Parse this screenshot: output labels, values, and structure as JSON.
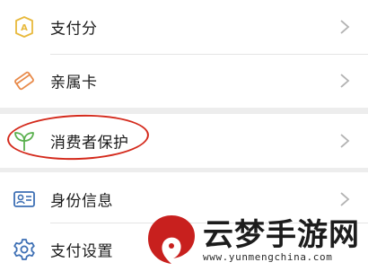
{
  "menu": {
    "group1": [
      {
        "label": "支付分",
        "icon": "score-badge-icon"
      },
      {
        "label": "亲属卡",
        "icon": "family-card-icon"
      }
    ],
    "group2": [
      {
        "label": "消费者保护",
        "icon": "sprout-icon",
        "highlighted": true
      }
    ],
    "group3": [
      {
        "label": "身份信息",
        "icon": "id-card-icon"
      },
      {
        "label": "支付设置",
        "icon": "gear-icon"
      }
    ]
  },
  "annotation": {
    "color": "#d42a1c"
  },
  "watermark": {
    "title": "云梦手游网",
    "url": "www.yunmengchina.com"
  },
  "colors": {
    "background": "#ededed",
    "card": "#ffffff",
    "icon_yellow": "#e8b93c",
    "icon_orange": "#e88a4a",
    "icon_green": "#5ab04e",
    "icon_blue": "#3d6fb4",
    "chevron": "#b3b3b3"
  }
}
